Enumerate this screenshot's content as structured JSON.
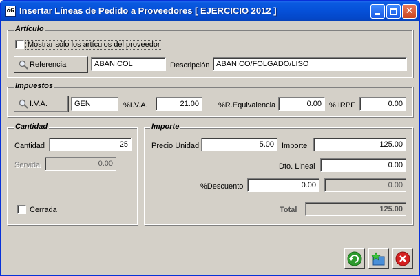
{
  "window": {
    "title": "Insertar Líneas de Pedido a Proveedores [ EJERCICIO 2012 ]",
    "app_icon_text": "óG"
  },
  "articulo": {
    "group_label": "Artículo",
    "checkbox_label": "Mostrar sólo los artículos del proveedor",
    "referencia_button": "Referencia",
    "referencia_value": "ABANICOL",
    "descripcion_label": "Descripción",
    "descripcion_value": "ABANICO/FOLGADO/LISO"
  },
  "impuestos": {
    "group_label": "Impuestos",
    "iva_button": "I.V.A.",
    "iva_code": "GEN",
    "iva_pct_label": "%I.V.A.",
    "iva_pct_value": "21.00",
    "req_label": "%R.Equivalencia",
    "req_value": "0.00",
    "irpf_label": "% IRPF",
    "irpf_value": "0.00"
  },
  "cantidad": {
    "group_label": "Cantidad",
    "cantidad_label": "Cantidad",
    "cantidad_value": "25",
    "servida_label": "Servida",
    "servida_value": "0.00",
    "cerrada_label": "Cerrada"
  },
  "importe": {
    "group_label": "Importe",
    "precio_label": "Precio Unidad",
    "precio_value": "5.00",
    "importe_label": "Importe",
    "importe_value": "125.00",
    "dto_label": "Dto. Lineal",
    "dto_value": "0.00",
    "descuento_label": "%Descuento",
    "descuento_value": "0.00",
    "descuento_amount": "0.00",
    "total_label": "Total",
    "total_value": "125.00"
  },
  "icons": {
    "refresh": "refresh-icon",
    "accept": "accept-icon",
    "cancel": "cancel-icon"
  },
  "colors": {
    "titlebar": "#0550d8",
    "window_bg": "#d4d0c8",
    "refresh_green": "#2e9a2e",
    "cancel_red": "#d42020"
  }
}
